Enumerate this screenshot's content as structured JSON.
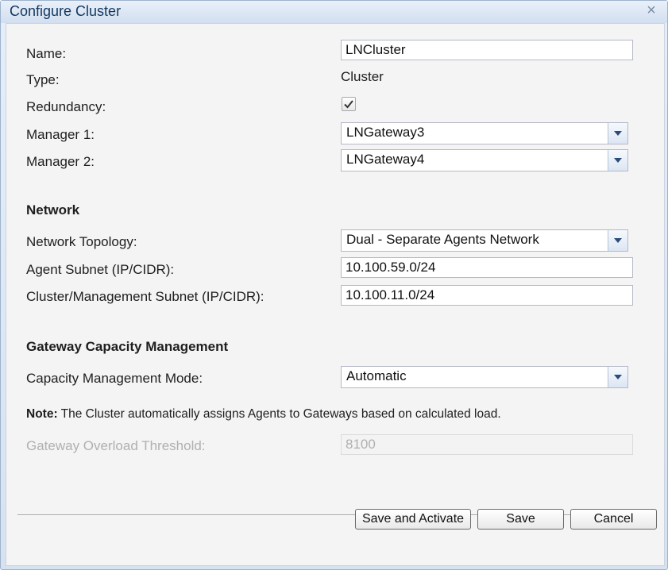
{
  "dialog": {
    "title": "Configure Cluster",
    "close_icon": "close-icon"
  },
  "general": {
    "name_label": "Name:",
    "name_value": "LNCluster",
    "type_label": "Type:",
    "type_value": "Cluster",
    "redundancy_label": "Redundancy:",
    "redundancy_checked": true,
    "manager1_label": "Manager 1:",
    "manager1_value": "LNGateway3",
    "manager2_label": "Manager 2:",
    "manager2_value": "LNGateway4"
  },
  "network": {
    "heading": "Network",
    "topology_label": "Network Topology:",
    "topology_value": "Dual - Separate Agents Network",
    "agent_subnet_label": "Agent Subnet (IP/CIDR):",
    "agent_subnet_value": "10.100.59.0/24",
    "cluster_subnet_label": "Cluster/Management Subnet (IP/CIDR):",
    "cluster_subnet_value": "10.100.11.0/24"
  },
  "capacity": {
    "heading": "Gateway Capacity Management",
    "mode_label": "Capacity Management Mode:",
    "mode_value": "Automatic",
    "note_prefix": "Note:",
    "note_text": " The Cluster automatically assigns Agents to Gateways based on calculated load.",
    "threshold_label": "Gateway Overload Threshold:",
    "threshold_value": "8100"
  },
  "buttons": {
    "save_activate": "Save and Activate",
    "save": "Save",
    "cancel": "Cancel"
  },
  "colors": {
    "title_text": "#12385f",
    "dialog_frame": "#9db3cd",
    "disabled_text": "#b0b0b0"
  }
}
